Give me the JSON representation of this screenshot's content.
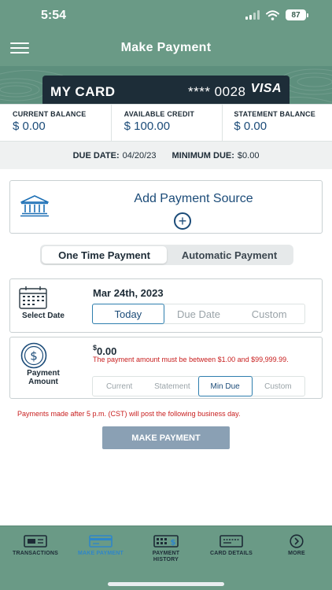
{
  "status_bar": {
    "time": "5:54",
    "battery": "87"
  },
  "header": {
    "title": "Make Payment"
  },
  "card": {
    "name": "MY CARD",
    "number": "**** 0028",
    "brand": "VISA"
  },
  "balances": [
    {
      "label": "CURRENT BALANCE",
      "value": "$ 0.00"
    },
    {
      "label": "AVAILABLE CREDIT",
      "value": "$ 100.00"
    },
    {
      "label": "STATEMENT BALANCE",
      "value": "$ 0.00"
    }
  ],
  "due": {
    "date_label": "DUE DATE:",
    "date_value": "04/20/23",
    "min_label": "MINIMUM DUE:",
    "min_value": "$0.00"
  },
  "add_source": {
    "label": "Add Payment Source",
    "plus": "+"
  },
  "payment_type": {
    "options": [
      "One Time Payment",
      "Automatic Payment"
    ],
    "selected": "One Time Payment"
  },
  "date_panel": {
    "label": "Select Date",
    "value": "Mar 24th, 2023",
    "options": [
      "Today",
      "Due Date",
      "Custom"
    ],
    "selected": "Today"
  },
  "amount_panel": {
    "label_line1": "Payment",
    "label_line2": "Amount",
    "currency": "$",
    "value": "0.00",
    "error": "The payment amount must be between $1.00 and $99,999.99.",
    "options": [
      "Current",
      "Statement",
      "Min Due",
      "Custom"
    ],
    "selected": "Min Due"
  },
  "notice": "Payments made after 5 p.m. (CST) will post the following business day.",
  "make_payment_button": "MAKE PAYMENT",
  "tabs": [
    {
      "label": "TRANSACTIONS",
      "icon": "transactions-icon"
    },
    {
      "label": "MAKE PAYMENT",
      "icon": "make-payment-icon",
      "active": true
    },
    {
      "label": "PAYMENT HISTORY",
      "icon": "payment-history-icon"
    },
    {
      "label": "CARD DETAILS",
      "icon": "card-details-icon"
    },
    {
      "label": "MORE",
      "icon": "more-icon"
    }
  ],
  "colors": {
    "header": "#6a9a86",
    "accent": "#1b4b78",
    "error": "#c81e1e",
    "card": "#1d2d38",
    "button_disabled": "#8aa0b4"
  }
}
